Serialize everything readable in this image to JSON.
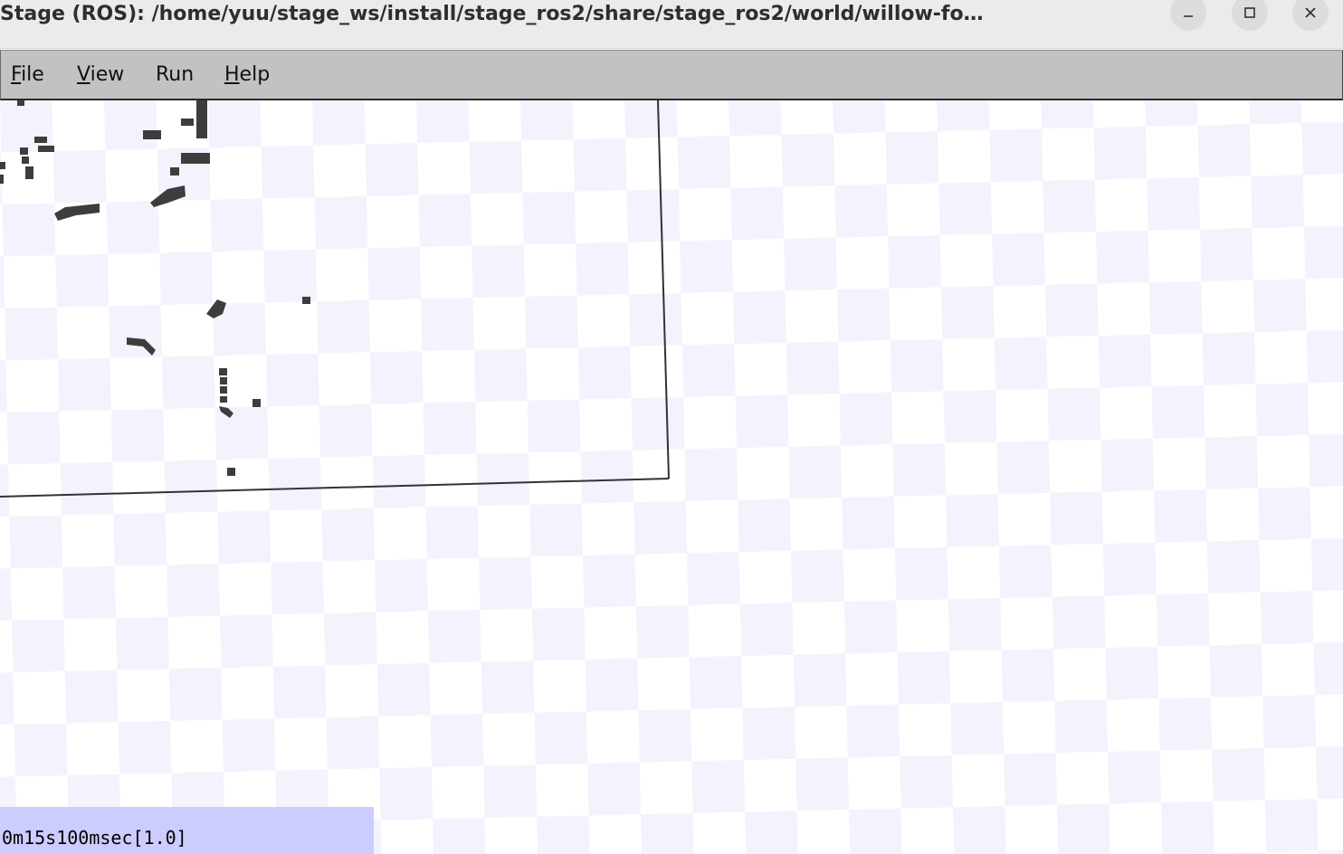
{
  "window": {
    "title": "Stage (ROS): /home/yuu/stage_ws/install/stage_ros2/share/stage_ros2/world/willow-fo…",
    "controls": {
      "minimize_icon": "minimize-icon",
      "maximize_icon": "maximize-icon",
      "close_icon": "close-icon"
    }
  },
  "menubar": {
    "items": [
      {
        "mnemonic": "F",
        "rest": "ile"
      },
      {
        "mnemonic": "V",
        "rest": "iew"
      },
      {
        "mnemonic": "",
        "rest": "Run"
      },
      {
        "mnemonic": "H",
        "rest": "elp"
      }
    ]
  },
  "status": {
    "text": "0m15s100msec[1.0]"
  },
  "colors": {
    "titlebar": "#ebebeb",
    "menubar": "#c2c2c2",
    "checker_light": "#f3f3fd",
    "checker_white": "#ffffff",
    "obstacle": "#3d3d3d",
    "status_bg": "#ccccff"
  }
}
